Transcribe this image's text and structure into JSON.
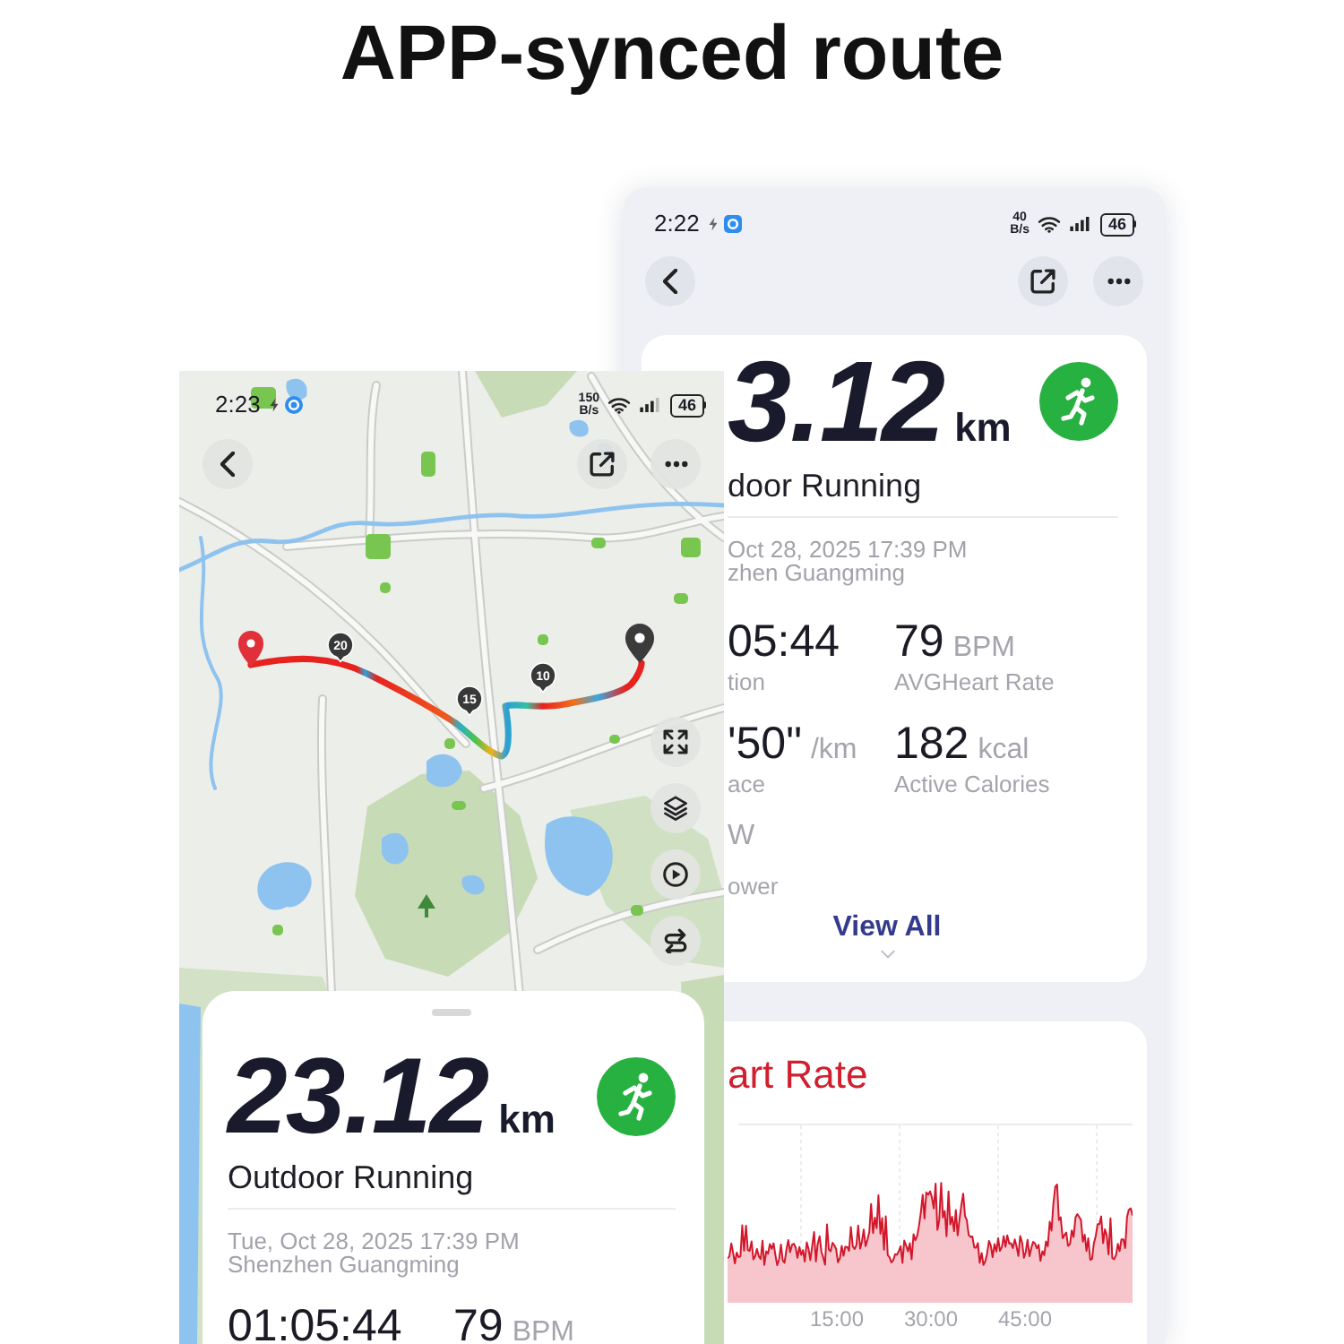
{
  "headline": "APP-synced route",
  "back_screen": {
    "status_bar": {
      "time": "2:22",
      "network_speed": "40",
      "network_speed_unit": "B/s",
      "battery": "46"
    },
    "summary": {
      "distance": "3.12",
      "distance_unit": "km",
      "activity": "door Running",
      "date": "Oct 28, 2025 17:39 PM",
      "location": "zhen Guangming",
      "stats": [
        {
          "value": "05:44",
          "label": "tion"
        },
        {
          "value": "79",
          "unit": "BPM",
          "label": "AVGHeart Rate"
        },
        {
          "value": "'50\"",
          "unit": "/km",
          "label": "ace"
        },
        {
          "value": "182",
          "unit": "kcal",
          "label": "Active Calories"
        },
        {
          "unit": "W",
          "label": "ower"
        }
      ],
      "view_all": "View All"
    },
    "heart_rate": {
      "title": "art Rate",
      "x_axis_labels": [
        "15:00",
        "30:00",
        "45:00"
      ]
    }
  },
  "front_screen": {
    "status_bar": {
      "time": "2:23",
      "network_speed": "150",
      "network_speed_unit": "B/s",
      "battery": "46"
    },
    "route_markers": [
      "20",
      "15",
      "10"
    ],
    "summary": {
      "distance": "23.12",
      "distance_unit": "km",
      "activity": "Outdoor Running",
      "date": "Tue, Oct 28, 2025 17:39 PM",
      "location": "Shenzhen Guangming",
      "stats": [
        {
          "value": "01:05:44"
        },
        {
          "value": "79",
          "unit": "BPM"
        }
      ]
    }
  }
}
